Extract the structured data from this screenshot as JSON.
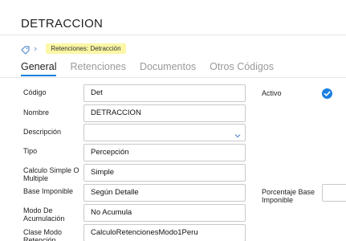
{
  "page": {
    "title": "DETRACCION"
  },
  "breadcrumb": {
    "current": "Retenciones: Detracción"
  },
  "tabs": [
    {
      "label": "General",
      "active": true
    },
    {
      "label": "Retenciones",
      "active": false
    },
    {
      "label": "Documentos",
      "active": false
    },
    {
      "label": "Otros Códigos",
      "active": false
    }
  ],
  "form": {
    "codigo": {
      "label": "Código",
      "value": "Det"
    },
    "nombre": {
      "label": "Nombre",
      "value": "DETRACCION"
    },
    "descripcion": {
      "label": "Descripción",
      "value": ""
    },
    "tipo": {
      "label": "Tipo",
      "value": "Percepción"
    },
    "calculo": {
      "label": "Calculo Simple O Multiple",
      "value": "Simple"
    },
    "base": {
      "label": "Base Imponible",
      "value": "Según Detalle"
    },
    "modo": {
      "label": "Modo De Acumulación",
      "value": "No Acumula"
    },
    "clase": {
      "label": "Clase Modo Retención",
      "value": "CalculoRetencionesModo1Peru"
    },
    "activo": {
      "label": "Activo",
      "checked": true
    },
    "porcentaje": {
      "label": "Porcentaje Base Imponible",
      "value": ""
    }
  },
  "colors": {
    "accent": "#1a7fe0",
    "badge": "#fbf7a6",
    "check": "#1a7fe0"
  }
}
